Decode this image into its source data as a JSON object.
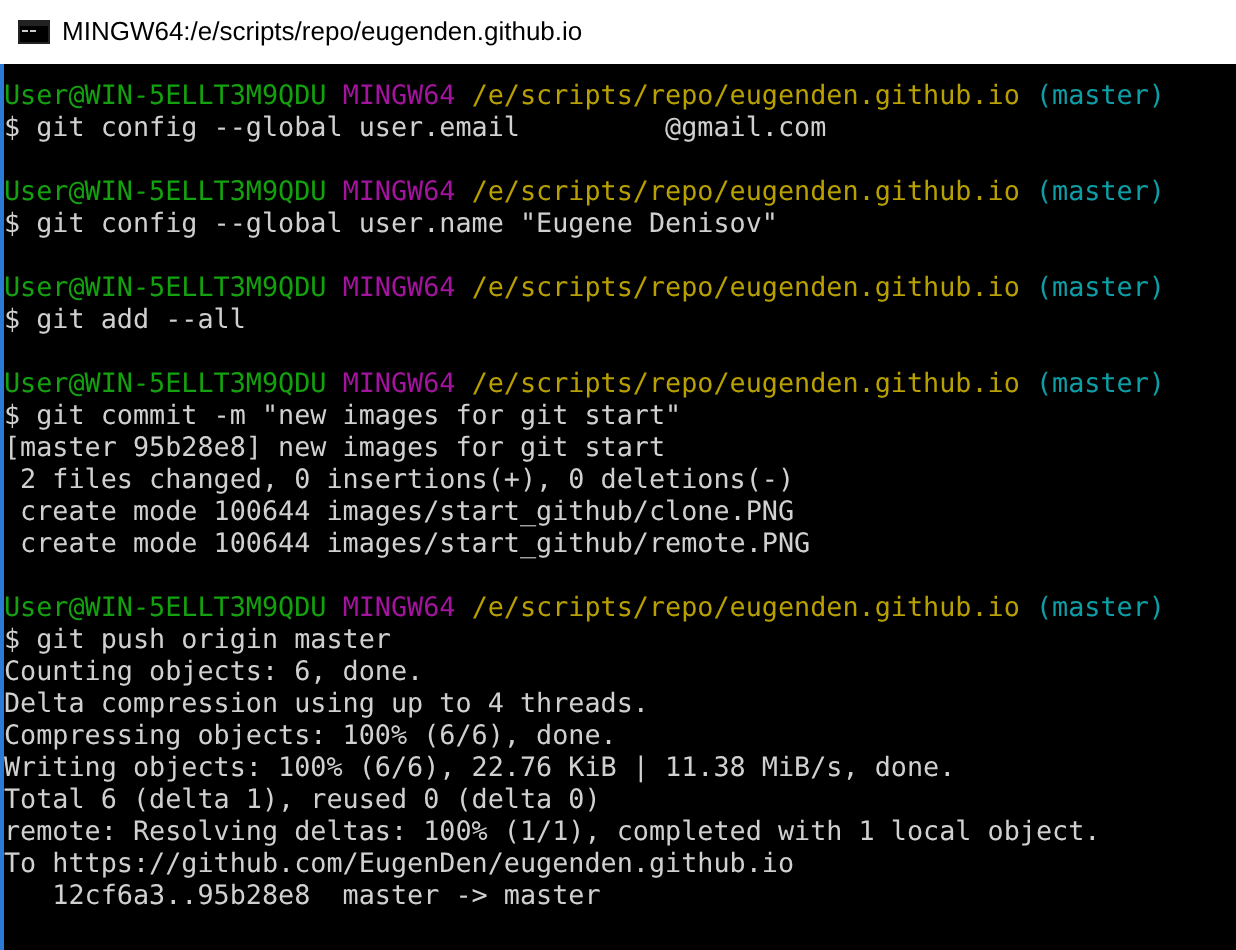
{
  "window": {
    "title": "MINGW64:/e/scripts/repo/eugenden.github.io"
  },
  "lines": [
    {
      "kind": "prompt",
      "user": "User@WIN-5ELLT3M9QDU",
      "system": "MINGW64",
      "path": "/e/scripts/repo/eugenden.github.io",
      "branch": "(master)"
    },
    {
      "kind": "command",
      "text": "$ git config --global user.email         @gmail.com"
    },
    {
      "kind": "blank"
    },
    {
      "kind": "prompt",
      "user": "User@WIN-5ELLT3M9QDU",
      "system": "MINGW64",
      "path": "/e/scripts/repo/eugenden.github.io",
      "branch": "(master)"
    },
    {
      "kind": "command",
      "text": "$ git config --global user.name \"Eugene Denisov\""
    },
    {
      "kind": "blank"
    },
    {
      "kind": "prompt",
      "user": "User@WIN-5ELLT3M9QDU",
      "system": "MINGW64",
      "path": "/e/scripts/repo/eugenden.github.io",
      "branch": "(master)"
    },
    {
      "kind": "command",
      "text": "$ git add --all"
    },
    {
      "kind": "blank"
    },
    {
      "kind": "prompt",
      "user": "User@WIN-5ELLT3M9QDU",
      "system": "MINGW64",
      "path": "/e/scripts/repo/eugenden.github.io",
      "branch": "(master)"
    },
    {
      "kind": "command",
      "text": "$ git commit -m \"new images for git start\""
    },
    {
      "kind": "output",
      "text": "[master 95b28e8] new images for git start"
    },
    {
      "kind": "output",
      "text": " 2 files changed, 0 insertions(+), 0 deletions(-)"
    },
    {
      "kind": "output",
      "text": " create mode 100644 images/start_github/clone.PNG"
    },
    {
      "kind": "output",
      "text": " create mode 100644 images/start_github/remote.PNG"
    },
    {
      "kind": "blank"
    },
    {
      "kind": "prompt",
      "user": "User@WIN-5ELLT3M9QDU",
      "system": "MINGW64",
      "path": "/e/scripts/repo/eugenden.github.io",
      "branch": "(master)"
    },
    {
      "kind": "command",
      "text": "$ git push origin master"
    },
    {
      "kind": "output",
      "text": "Counting objects: 6, done."
    },
    {
      "kind": "output",
      "text": "Delta compression using up to 4 threads."
    },
    {
      "kind": "output",
      "text": "Compressing objects: 100% (6/6), done."
    },
    {
      "kind": "output",
      "text": "Writing objects: 100% (6/6), 22.76 KiB | 11.38 MiB/s, done."
    },
    {
      "kind": "output",
      "text": "Total 6 (delta 1), reused 0 (delta 0)"
    },
    {
      "kind": "output",
      "text": "remote: Resolving deltas: 100% (1/1), completed with 1 local object."
    },
    {
      "kind": "output",
      "text": "To https://github.com/EugenDen/eugenden.github.io"
    },
    {
      "kind": "output",
      "text": "   12cf6a3..95b28e8  master -> master"
    }
  ]
}
